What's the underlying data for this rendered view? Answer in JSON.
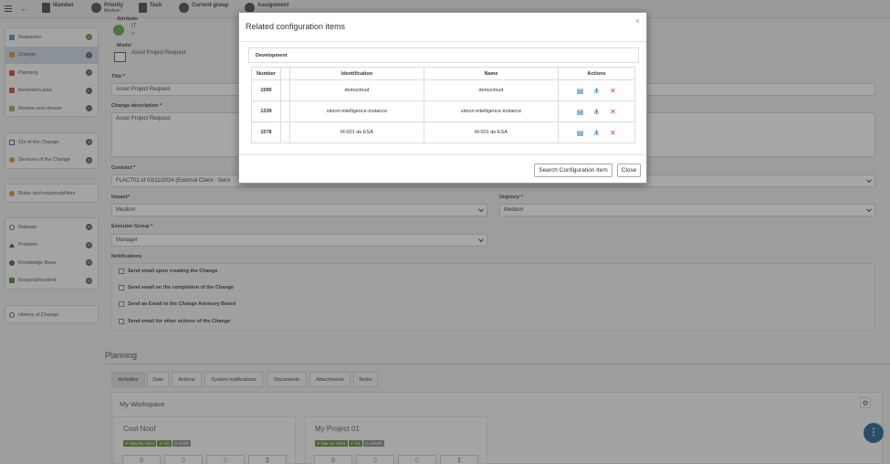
{
  "topbar": {
    "number_label": "Number",
    "priority_label": "Priority",
    "priority_value": "Medium",
    "task_label": "Task",
    "current_group_label": "Current group",
    "assignment_label": "Assignment"
  },
  "sidebar": {
    "group1": [
      {
        "label": "Requester",
        "badge": "✓",
        "ok": true
      },
      {
        "label": "Change",
        "badge": "✓",
        "ok": false,
        "selected": true
      },
      {
        "label": "Planning",
        "badge": "✓",
        "ok": false
      },
      {
        "label": "Reversion plan",
        "badge": "✓",
        "ok": false
      },
      {
        "label": "Review and closure",
        "badge": "✓",
        "ok": false
      }
    ],
    "cis": {
      "label": "CIs of the Change",
      "badge": "3"
    },
    "services": {
      "label": "Services of the Change",
      "badge": "0"
    },
    "roles": {
      "label": "Roles and responsibilities"
    },
    "group4": [
      {
        "label": "Release",
        "badge": "0"
      },
      {
        "label": "Problem",
        "badge": "0"
      },
      {
        "label": "Knowledge Base",
        "badge": "0"
      },
      {
        "label": "Request/Incident",
        "badge": "0"
      }
    ],
    "history": {
      "label": "History of Change"
    }
  },
  "form": {
    "attribute_label": "Attribute",
    "attribute_value": "IT",
    "attribute_sub": "IT",
    "model_label": "Model",
    "model_value": "Asset Project Request",
    "title_label": "Title *",
    "title_value": "Asset Project Request",
    "desc_label": "Change description *",
    "desc_value": "Asset Project Request",
    "contract_label": "Contract *",
    "contract_value": "FLACT02 of 03/11/2024 (External Client - Servi",
    "impact_label": "Impact*",
    "impact_value": "Medium",
    "urgency_label": "Urgency *",
    "urgency_value": "Medium",
    "executor_label": "Executor Group *",
    "executor_value": "Manager",
    "notifications_label": "Notifications",
    "notifications": [
      "Send email upon creating the Change",
      "Send email on the completion of the Change",
      "Send an Email to the Change Advisory Board",
      "Send email for other actions of the Change"
    ]
  },
  "planning": {
    "heading": "Planning",
    "tabs": [
      "Activities",
      "Date",
      "Actions",
      "System notifications",
      "Documents",
      "Attachments",
      "Notes"
    ],
    "workspace_title": "My Workspace",
    "cards": [
      {
        "title": "Cost Noof",
        "date": "May 08, 2024",
        "check": "2/2",
        "time": "3h/0h",
        "counts": [
          "0",
          "0",
          "0",
          "2"
        ]
      },
      {
        "title": "My Project 01",
        "date": "Mar 16, 2024",
        "check": "1/1",
        "time": "15h/0h",
        "counts": [
          "0",
          "0",
          "0",
          "1"
        ]
      }
    ]
  },
  "modal": {
    "title": "Related configuration items",
    "close_symbol": "×",
    "section": "Development",
    "columns": [
      "Number",
      "Identification",
      "Name",
      "Actions"
    ],
    "rows": [
      {
        "number": "1590",
        "identification": "democloud",
        "name": "democloud"
      },
      {
        "number": "1339",
        "identification": "simon-intelligence-instance",
        "name": "simon-intelligence-instance"
      },
      {
        "number": "1078",
        "identification": "M-001 de ESA",
        "name": "M-001 de ESA"
      }
    ],
    "search_button": "Search Configuration Item",
    "close_button": "Close"
  },
  "colors": {
    "accent": "#1f6fb2",
    "delete": "#d9372b",
    "ok_green": "#5d8a2f",
    "fab": "#1a5e8a"
  }
}
